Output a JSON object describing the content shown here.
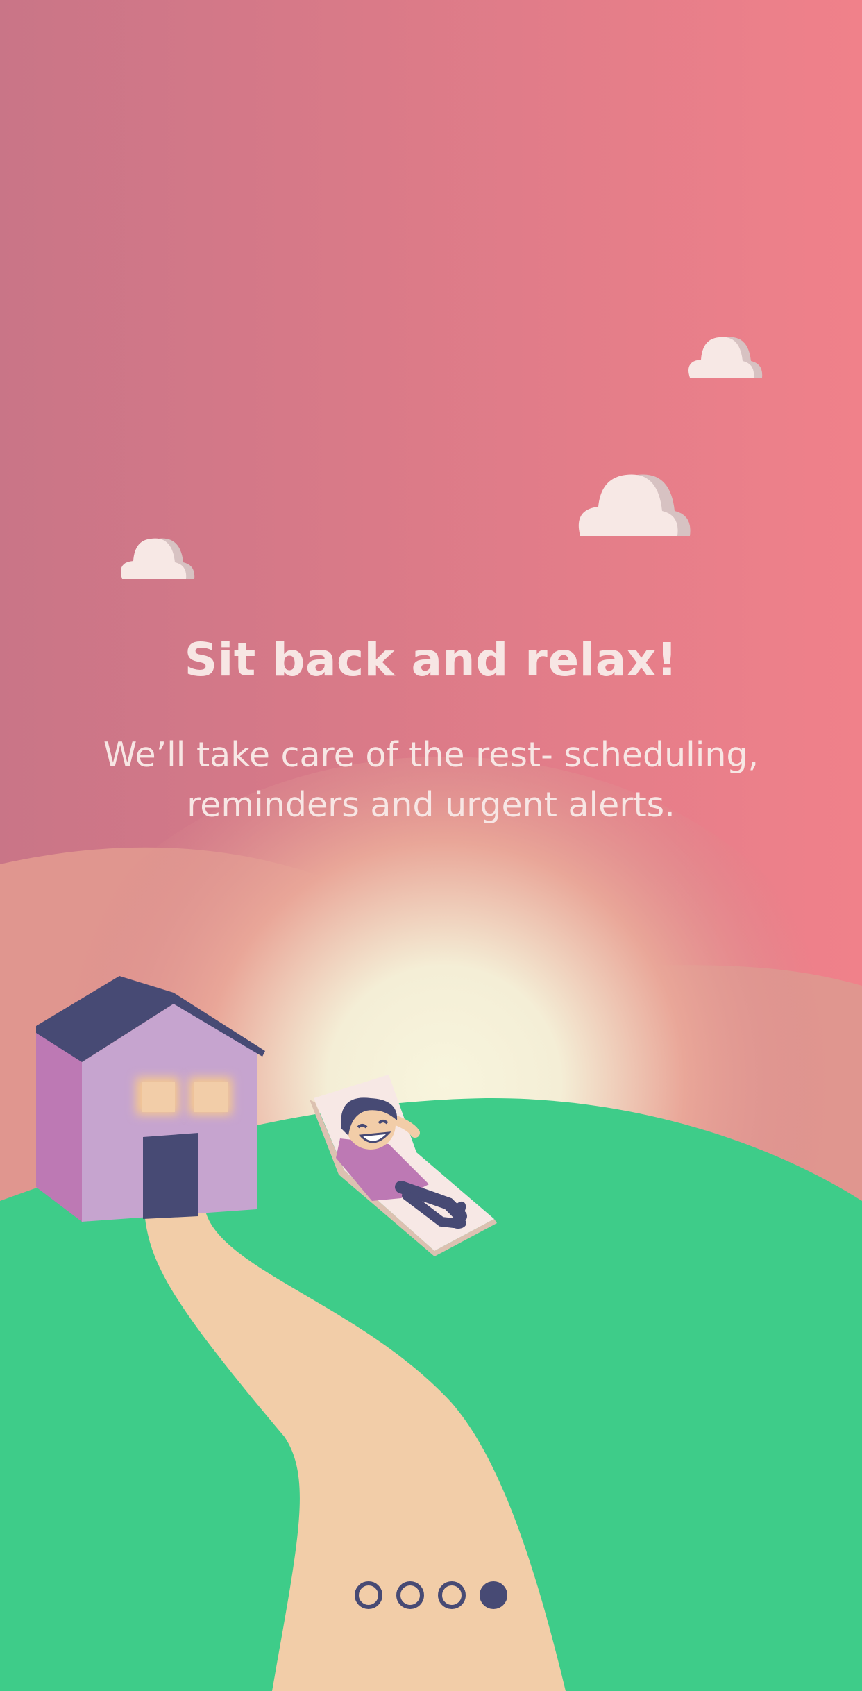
{
  "onboarding": {
    "title": "Sit back and relax!",
    "description_line1": "We’ll take care of the rest- scheduling,",
    "description_line2": "reminders and urgent alerts."
  },
  "pager": {
    "total_pages": 4,
    "current_page": 4
  },
  "colors": {
    "sky_left": "#c97587",
    "sky_right": "#f0818a",
    "grass": "#3ecc89",
    "path": "#f2cda8",
    "text": "#f7e6e4",
    "dot": "#474a74"
  }
}
